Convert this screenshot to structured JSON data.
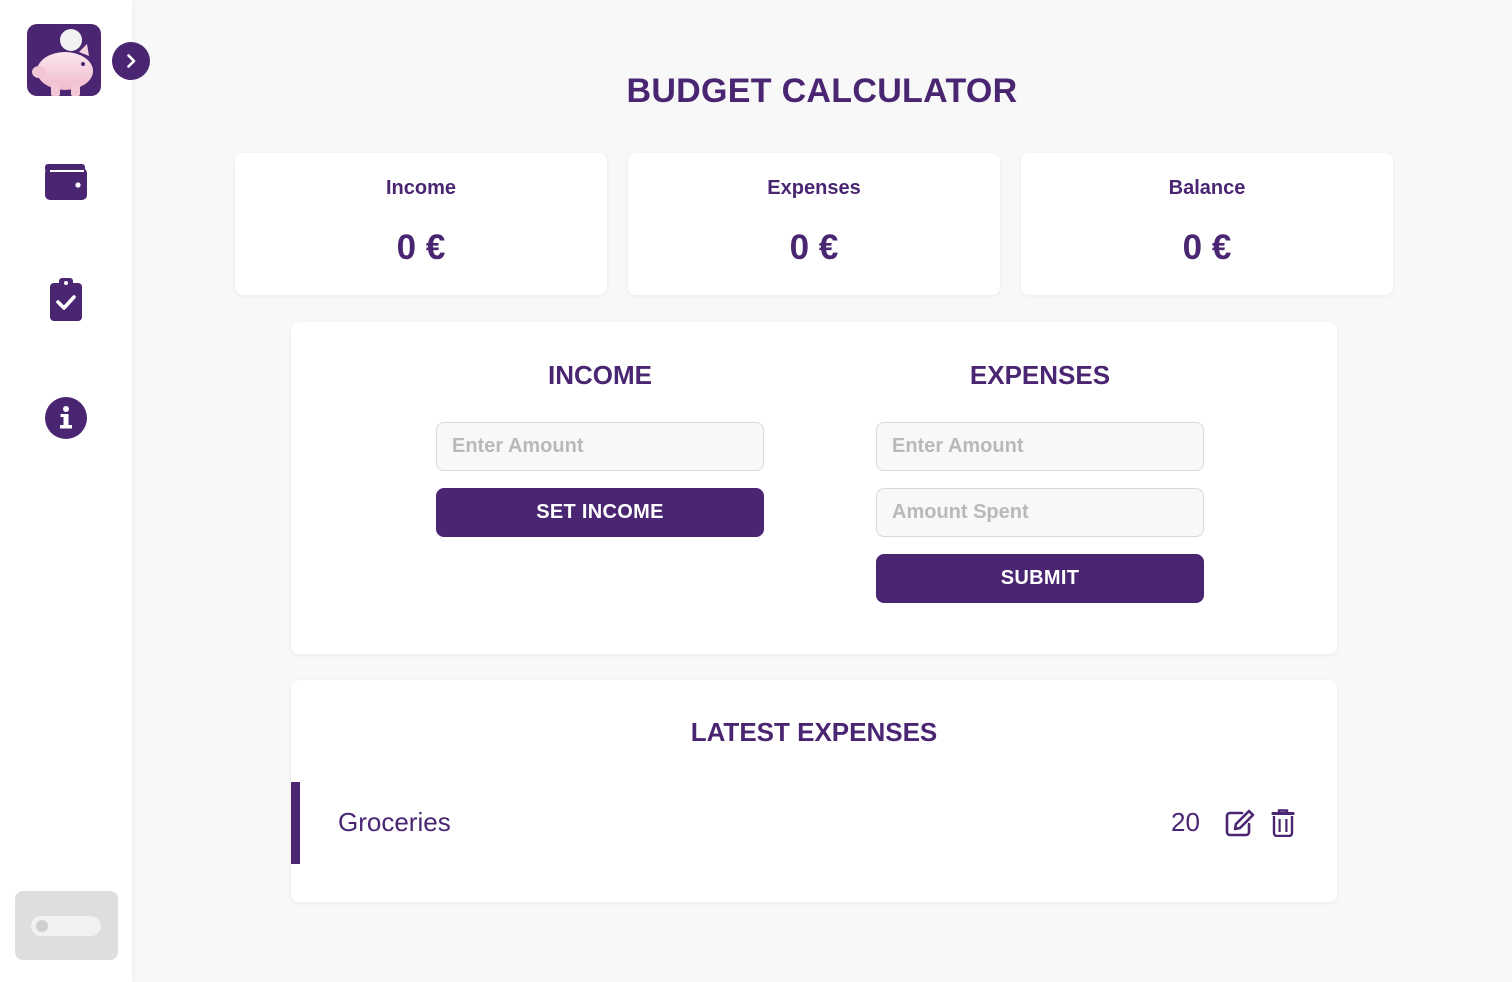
{
  "app": {
    "title": "BUDGET CALCULATOR",
    "brand_color": "#4a2672",
    "background": "#f8f8f8"
  },
  "sidebar": {
    "logo_icon": "piggy-bank-coin-icon",
    "toggle_icon": "chevron-right-icon",
    "items": [
      {
        "name": "wallet",
        "icon": "wallet-icon"
      },
      {
        "name": "tasks",
        "icon": "clipboard-check-icon"
      },
      {
        "name": "info",
        "icon": "info-circle-icon"
      }
    ],
    "theme_toggle": {
      "state": "off"
    }
  },
  "summary": {
    "income": {
      "label": "Income",
      "value": "0 €"
    },
    "expenses": {
      "label": "Expenses",
      "value": "0 €"
    },
    "balance": {
      "label": "Balance",
      "value": "0 €"
    }
  },
  "income_form": {
    "title": "INCOME",
    "amount_placeholder": "Enter Amount",
    "amount_value": "",
    "button_label": "SET INCOME"
  },
  "expense_form": {
    "title": "EXPENSES",
    "amount_placeholder": "Enter Amount",
    "amount_value": "",
    "spent_placeholder": "Amount Spent",
    "spent_value": "",
    "button_label": "SUBMIT"
  },
  "latest_expenses": {
    "title": "LATEST EXPENSES",
    "items": [
      {
        "name": "Groceries",
        "amount": "20",
        "edit_icon": "edit-icon",
        "delete_icon": "trash-icon"
      }
    ]
  }
}
